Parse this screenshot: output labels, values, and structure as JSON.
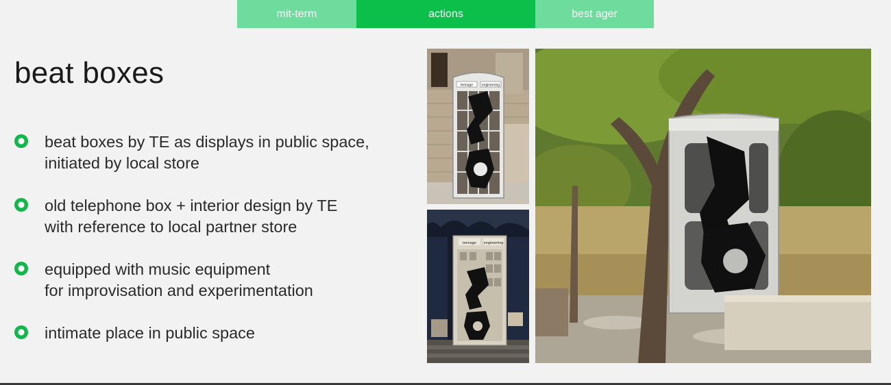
{
  "nav": {
    "tabs": [
      {
        "label": "mit-term"
      },
      {
        "label": "actions"
      },
      {
        "label": "best ager"
      }
    ],
    "active_index": 1
  },
  "slide": {
    "title": "beat boxes",
    "bullets": [
      {
        "lines": [
          "beat boxes by TE as displays in public space,",
          "initiated by local store"
        ]
      },
      {
        "lines": [
          "old telephone box + interior design by TE",
          "with reference to local partner store"
        ]
      },
      {
        "lines": [
          "equipped with music equipment",
          "for improvisation and experimentation"
        ]
      },
      {
        "lines": [
          "intimate place in public space"
        ]
      }
    ]
  },
  "photos": {
    "sign_left": "teenage",
    "sign_right": "engineering"
  },
  "colors": {
    "accent": "#0cbf4a",
    "accent_light": "#6ddc9c",
    "background": "#f2f2f2"
  }
}
